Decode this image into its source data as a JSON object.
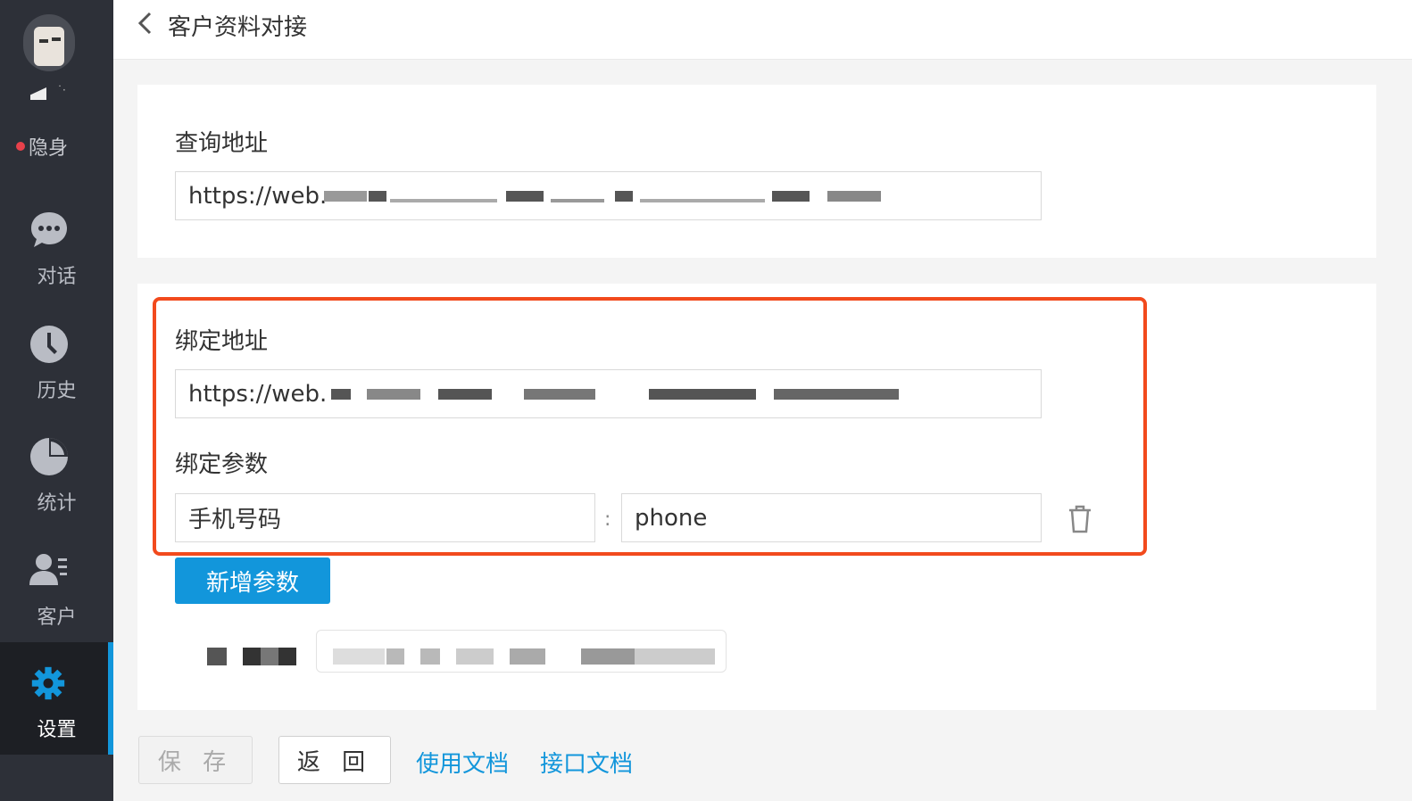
{
  "sidebar": {
    "status_label": "隐身",
    "items": [
      {
        "label": "对话",
        "icon": "chat-icon"
      },
      {
        "label": "历史",
        "icon": "clock-icon"
      },
      {
        "label": "统计",
        "icon": "pie-chart-icon"
      },
      {
        "label": "客户",
        "icon": "customer-icon"
      },
      {
        "label": "设置",
        "icon": "gear-icon",
        "active": true
      }
    ]
  },
  "header": {
    "back_icon": "chevron-left-icon",
    "title": "客户资料对接"
  },
  "query": {
    "label": "查询地址",
    "url": "https://web."
  },
  "bind": {
    "label": "绑定地址",
    "url": "https://web.",
    "params_label": "绑定参数",
    "param_key": "手机号码",
    "param_value": "phone",
    "separator": ":"
  },
  "actions": {
    "add_param": "新增参数",
    "save": "保 存",
    "back": "返 回",
    "usage_doc": "使用文档",
    "api_doc": "接口文档"
  },
  "colors": {
    "accent": "#1296db",
    "highlight": "#f24a1d",
    "sidebar_bg": "#2d3038"
  }
}
